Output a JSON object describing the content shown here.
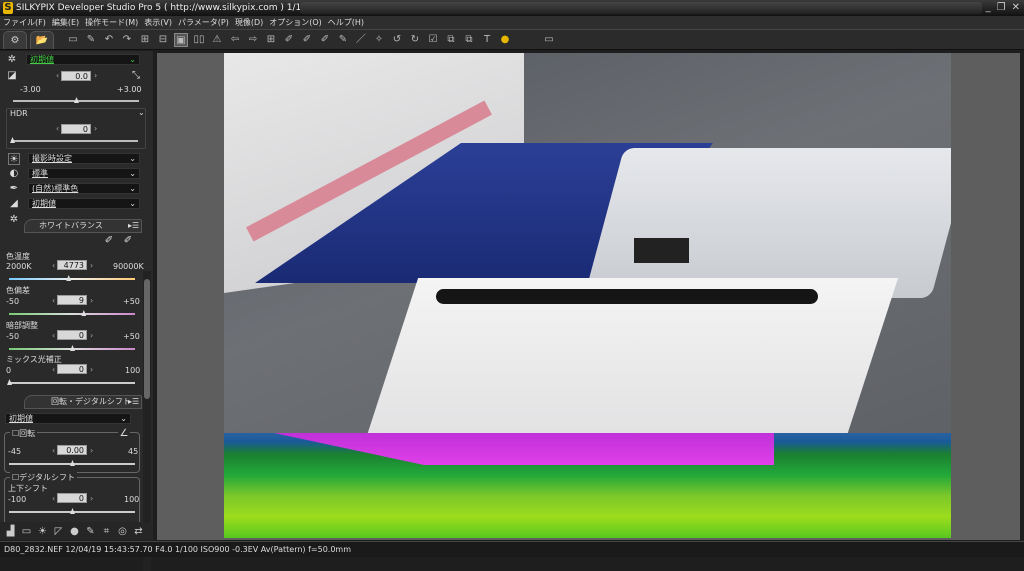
{
  "window": {
    "title": "SILKYPIX Developer Studio Pro 5 ( http://www.silkypix.com )  1/1",
    "minimize": "_",
    "restore": "❐",
    "close": "✕"
  },
  "menu": [
    "ファイル(F)",
    "編集(E)",
    "操作モード(M)",
    "表示(V)",
    "パラメータ(P)",
    "現像(D)",
    "オプション(O)",
    "ヘルプ(H)"
  ],
  "exposure": {
    "preset": "初期値",
    "value": "0.0",
    "min": "-3.00",
    "max": "+3.00",
    "fraction": 0.5
  },
  "hdr": {
    "label": "HDR",
    "value": "0",
    "fraction": 0.0
  },
  "presets": {
    "shooting": "撮影時設定",
    "tone": "標準",
    "color": "(自然)標準色",
    "sharpness": "初期値"
  },
  "white_balance": {
    "title": "ホワイトバランス",
    "temp": {
      "label": "色温度",
      "value": "4773",
      "min": "2000K",
      "max": "90000K",
      "fraction": 0.47
    },
    "tint": {
      "label": "色偏差",
      "value": "9",
      "min": "-50",
      "max": "+50",
      "fraction": 0.59
    },
    "shadow": {
      "label": "暗部調整",
      "value": "0",
      "min": "-50",
      "max": "+50",
      "fraction": 0.5
    },
    "mix": {
      "label": "ミックス光補正",
      "value": "0",
      "min": "0",
      "max": "100",
      "fraction": 0.0
    }
  },
  "rotation": {
    "title": "回転・デジタルシフト",
    "preset": "初期値",
    "rotate_label": "回転",
    "rotate_value": "0.00",
    "rotate_min": "-45",
    "rotate_max": "45",
    "shift_label": "デジタルシフト",
    "vshift_label": "上下シフト",
    "vshift_value": "0",
    "vshift_min": "-100",
    "vshift_max": "100"
  },
  "status": "D80_2832.NEF 12/04/19 15:43:57.70 F4.0 1/100 ISO900 -0.3EV Av(Pattern) f=50.0mm"
}
